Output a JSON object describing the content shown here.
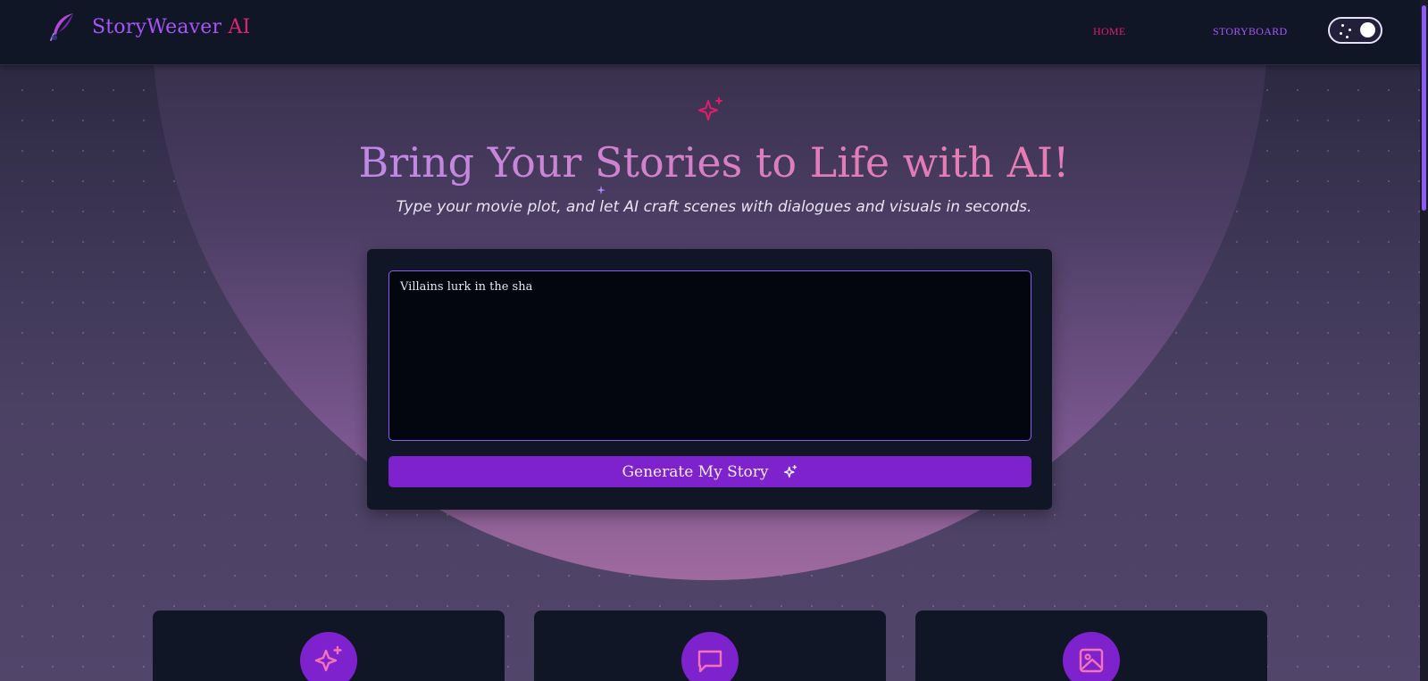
{
  "nav": {
    "brand_main": "StoryWeaver",
    "brand_accent": "AI",
    "links": [
      "HOME",
      "STORYBOARD"
    ],
    "theme_toggle": "dark"
  },
  "hero": {
    "title": "Bring Your Stories to Life with AI!",
    "subtitle": "Type your movie plot, and let AI craft scenes with dialogues and visuals in seconds."
  },
  "prompt": {
    "value": "Villains lurk in the sha",
    "button_label": "Generate My Story"
  },
  "features": [
    {
      "icon": "sparkles-icon"
    },
    {
      "icon": "message-square-icon"
    },
    {
      "icon": "image-icon"
    }
  ],
  "colors": {
    "accent_purple": "#7e22ce",
    "accent_pink": "#db2777",
    "nav_bg": "#111627"
  }
}
